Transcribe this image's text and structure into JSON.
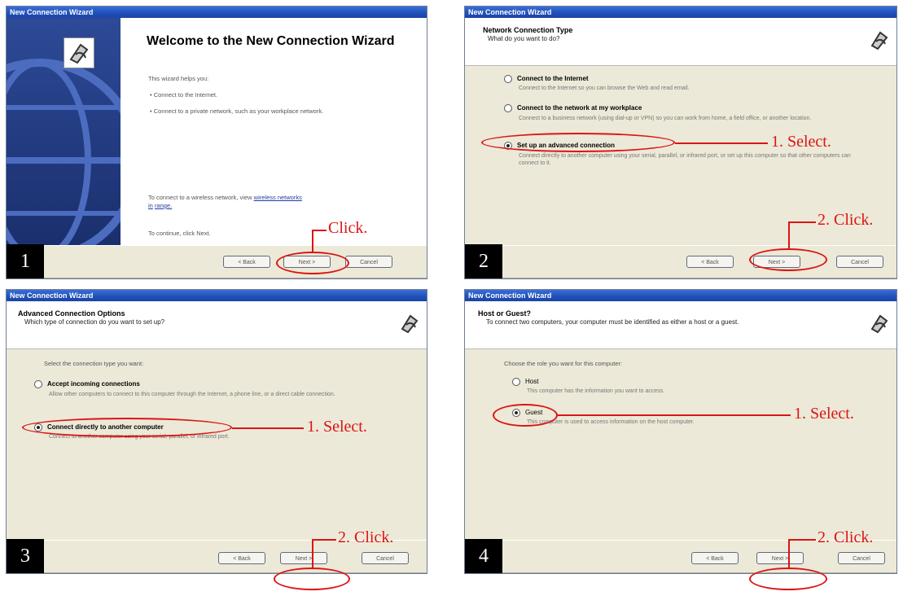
{
  "window_title": "New Connection Wizard",
  "panel1": {
    "step": "1",
    "heading": "Welcome to the New Connection Wizard",
    "intro": "This wizard helps you:",
    "bullets": [
      "Connect to the Internet.",
      "Connect to a private network, such as your workplace network."
    ],
    "wireless_text": "To connect to a wireless network, view",
    "wireless_link": "wireless networks in",
    "wireless_link2": "range.",
    "continue_text": "To continue, click Next.",
    "annotation": "Click."
  },
  "panel2": {
    "step": "2",
    "title": "Network Connection Type",
    "subtitle": "What do you want to do?",
    "options": [
      {
        "label": "Connect to the Internet",
        "desc": "Connect to the Internet so you can browse the Web and read email."
      },
      {
        "label": "Connect to the network at my workplace",
        "desc": "Connect to a business network (using dial-up or VPN) so you can work from home, a field office, or another location."
      },
      {
        "label": "Set up an advanced connection",
        "desc": "Connect directly to another computer using your serial, parallel, or infrared port, or set up this computer so that other computers can connect to it."
      }
    ],
    "annotation_select": "1. Select.",
    "annotation_click": "2. Click."
  },
  "panel3": {
    "step": "3",
    "title": "Advanced Connection Options",
    "subtitle": "Which type of connection do you want to set up?",
    "prompt": "Select the connection type you want:",
    "options": [
      {
        "label": "Accept incoming connections",
        "desc": "Allow other computers to connect to this computer through the Internet, a phone line, or a direct cable connection."
      },
      {
        "label": "Connect directly to another computer",
        "desc": "Connect to another computer using your serial, parallel, or infrared port."
      }
    ],
    "annotation_select": "1. Select.",
    "annotation_click": "2. Click."
  },
  "panel4": {
    "step": "4",
    "title": "Host or Guest?",
    "subtitle": "To connect two computers, your computer must be identified as either a host or a guest.",
    "prompt": "Choose the role you want for this computer:",
    "options": [
      {
        "label": "Host",
        "desc": "This computer has the information you want to access."
      },
      {
        "label": "Guest",
        "desc": "This computer is used to access information on the host computer."
      }
    ],
    "annotation_select": "1. Select.",
    "annotation_click": "2. Click."
  },
  "buttons": {
    "back": "< Back",
    "next": "Next >",
    "cancel": "Cancel"
  },
  "colors": {
    "annotation": "#dc1414",
    "titlebar": "#1f4fb8"
  }
}
